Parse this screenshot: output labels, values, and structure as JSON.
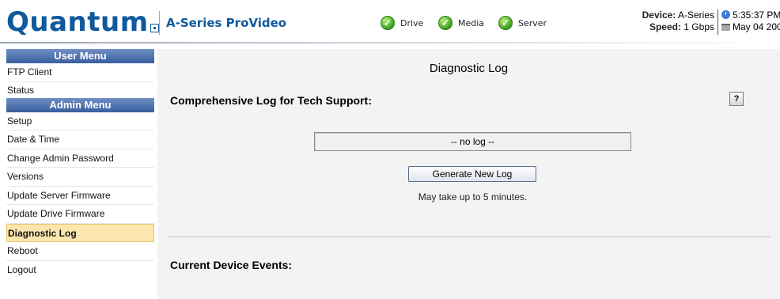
{
  "header": {
    "logo": "Quantum",
    "product": "A-Series ProVideo",
    "statuses": [
      {
        "label": "Drive",
        "icon": "check-circle-icon",
        "color": "#3aa020"
      },
      {
        "label": "Media",
        "icon": "check-circle-icon",
        "color": "#3aa020"
      },
      {
        "label": "Server",
        "icon": "check-circle-icon",
        "color": "#3aa020"
      }
    ],
    "device_label": "Device:",
    "device_value": "A-Series",
    "speed_label": "Speed:",
    "speed_value": "1 Gbps",
    "time": "5:35:37 PM",
    "date": "May 04 200"
  },
  "sidebar": {
    "user_menu_title": "User Menu",
    "user_items": [
      {
        "label": "FTP Client"
      },
      {
        "label": "Status"
      }
    ],
    "admin_menu_title": "Admin Menu",
    "admin_items": [
      {
        "label": "Setup"
      },
      {
        "label": "Date & Time"
      },
      {
        "label": "Change Admin Password"
      },
      {
        "label": "Versions"
      },
      {
        "label": "Update Server Firmware"
      },
      {
        "label": "Update Drive Firmware"
      },
      {
        "label": "Diagnostic Log"
      },
      {
        "label": "Reboot"
      },
      {
        "label": "Logout"
      }
    ],
    "active_item": "Diagnostic Log"
  },
  "main": {
    "title": "Diagnostic Log",
    "comprehensive_label": "Comprehensive Log for Tech Support:",
    "help_label": "?",
    "log_value": "-- no log --",
    "generate_button": "Generate New Log",
    "note": "May take up to 5 minutes.",
    "events_label": "Current Device Events:"
  },
  "colors": {
    "brand": "#0f5a9c",
    "menu_header": "#3a5e9e",
    "active_item_bg": "#fbe6ad",
    "main_bg": "#f3f3f3"
  }
}
